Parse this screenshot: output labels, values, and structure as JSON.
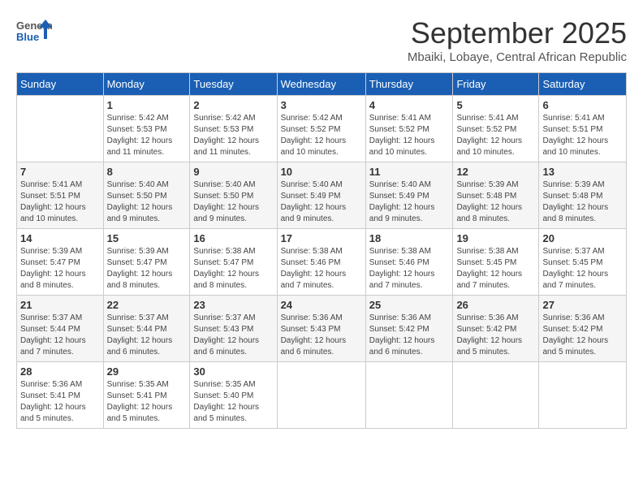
{
  "logo": {
    "text_general": "General",
    "text_blue": "Blue"
  },
  "header": {
    "month": "September 2025",
    "location": "Mbaiki, Lobaye, Central African Republic"
  },
  "columns": [
    "Sunday",
    "Monday",
    "Tuesday",
    "Wednesday",
    "Thursday",
    "Friday",
    "Saturday"
  ],
  "weeks": [
    [
      {
        "day": "",
        "info": ""
      },
      {
        "day": "1",
        "info": "Sunrise: 5:42 AM\nSunset: 5:53 PM\nDaylight: 12 hours\nand 11 minutes."
      },
      {
        "day": "2",
        "info": "Sunrise: 5:42 AM\nSunset: 5:53 PM\nDaylight: 12 hours\nand 11 minutes."
      },
      {
        "day": "3",
        "info": "Sunrise: 5:42 AM\nSunset: 5:52 PM\nDaylight: 12 hours\nand 10 minutes."
      },
      {
        "day": "4",
        "info": "Sunrise: 5:41 AM\nSunset: 5:52 PM\nDaylight: 12 hours\nand 10 minutes."
      },
      {
        "day": "5",
        "info": "Sunrise: 5:41 AM\nSunset: 5:52 PM\nDaylight: 12 hours\nand 10 minutes."
      },
      {
        "day": "6",
        "info": "Sunrise: 5:41 AM\nSunset: 5:51 PM\nDaylight: 12 hours\nand 10 minutes."
      }
    ],
    [
      {
        "day": "7",
        "info": "Sunrise: 5:41 AM\nSunset: 5:51 PM\nDaylight: 12 hours\nand 10 minutes."
      },
      {
        "day": "8",
        "info": "Sunrise: 5:40 AM\nSunset: 5:50 PM\nDaylight: 12 hours\nand 9 minutes."
      },
      {
        "day": "9",
        "info": "Sunrise: 5:40 AM\nSunset: 5:50 PM\nDaylight: 12 hours\nand 9 minutes."
      },
      {
        "day": "10",
        "info": "Sunrise: 5:40 AM\nSunset: 5:49 PM\nDaylight: 12 hours\nand 9 minutes."
      },
      {
        "day": "11",
        "info": "Sunrise: 5:40 AM\nSunset: 5:49 PM\nDaylight: 12 hours\nand 9 minutes."
      },
      {
        "day": "12",
        "info": "Sunrise: 5:39 AM\nSunset: 5:48 PM\nDaylight: 12 hours\nand 8 minutes."
      },
      {
        "day": "13",
        "info": "Sunrise: 5:39 AM\nSunset: 5:48 PM\nDaylight: 12 hours\nand 8 minutes."
      }
    ],
    [
      {
        "day": "14",
        "info": "Sunrise: 5:39 AM\nSunset: 5:47 PM\nDaylight: 12 hours\nand 8 minutes."
      },
      {
        "day": "15",
        "info": "Sunrise: 5:39 AM\nSunset: 5:47 PM\nDaylight: 12 hours\nand 8 minutes."
      },
      {
        "day": "16",
        "info": "Sunrise: 5:38 AM\nSunset: 5:47 PM\nDaylight: 12 hours\nand 8 minutes."
      },
      {
        "day": "17",
        "info": "Sunrise: 5:38 AM\nSunset: 5:46 PM\nDaylight: 12 hours\nand 7 minutes."
      },
      {
        "day": "18",
        "info": "Sunrise: 5:38 AM\nSunset: 5:46 PM\nDaylight: 12 hours\nand 7 minutes."
      },
      {
        "day": "19",
        "info": "Sunrise: 5:38 AM\nSunset: 5:45 PM\nDaylight: 12 hours\nand 7 minutes."
      },
      {
        "day": "20",
        "info": "Sunrise: 5:37 AM\nSunset: 5:45 PM\nDaylight: 12 hours\nand 7 minutes."
      }
    ],
    [
      {
        "day": "21",
        "info": "Sunrise: 5:37 AM\nSunset: 5:44 PM\nDaylight: 12 hours\nand 7 minutes."
      },
      {
        "day": "22",
        "info": "Sunrise: 5:37 AM\nSunset: 5:44 PM\nDaylight: 12 hours\nand 6 minutes."
      },
      {
        "day": "23",
        "info": "Sunrise: 5:37 AM\nSunset: 5:43 PM\nDaylight: 12 hours\nand 6 minutes."
      },
      {
        "day": "24",
        "info": "Sunrise: 5:36 AM\nSunset: 5:43 PM\nDaylight: 12 hours\nand 6 minutes."
      },
      {
        "day": "25",
        "info": "Sunrise: 5:36 AM\nSunset: 5:42 PM\nDaylight: 12 hours\nand 6 minutes."
      },
      {
        "day": "26",
        "info": "Sunrise: 5:36 AM\nSunset: 5:42 PM\nDaylight: 12 hours\nand 5 minutes."
      },
      {
        "day": "27",
        "info": "Sunrise: 5:36 AM\nSunset: 5:42 PM\nDaylight: 12 hours\nand 5 minutes."
      }
    ],
    [
      {
        "day": "28",
        "info": "Sunrise: 5:36 AM\nSunset: 5:41 PM\nDaylight: 12 hours\nand 5 minutes."
      },
      {
        "day": "29",
        "info": "Sunrise: 5:35 AM\nSunset: 5:41 PM\nDaylight: 12 hours\nand 5 minutes."
      },
      {
        "day": "30",
        "info": "Sunrise: 5:35 AM\nSunset: 5:40 PM\nDaylight: 12 hours\nand 5 minutes."
      },
      {
        "day": "",
        "info": ""
      },
      {
        "day": "",
        "info": ""
      },
      {
        "day": "",
        "info": ""
      },
      {
        "day": "",
        "info": ""
      }
    ]
  ]
}
